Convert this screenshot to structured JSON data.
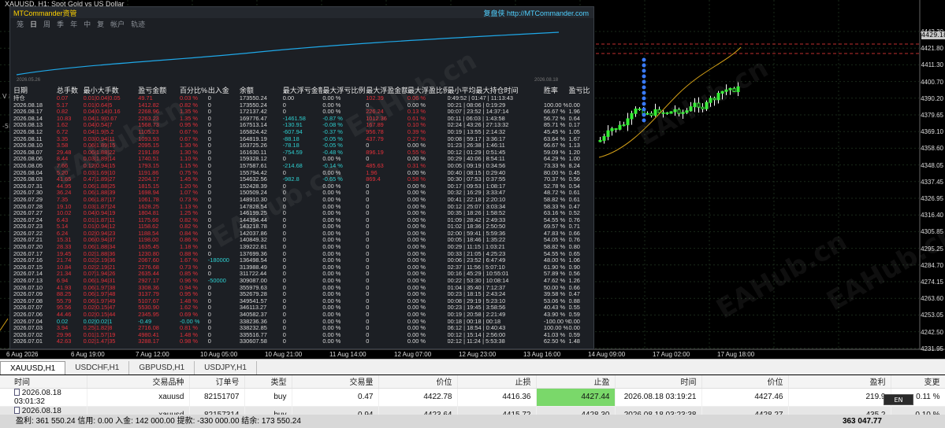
{
  "chart": {
    "title": "XAUUSD, H1:  Spot Gold vs US Dollar",
    "prices": [
      "4442.30",
      "4421.80",
      "4411.30",
      "4400.70",
      "4390.20",
      "4379.65",
      "4369.10",
      "4358.60",
      "4348.05",
      "4337.45",
      "4326.95",
      "4316.40",
      "4305.85",
      "4295.25",
      "4284.70",
      "4274.15",
      "4263.60",
      "4253.05",
      "4242.50",
      "4231.95"
    ],
    "current_price": "4429.18",
    "times": [
      "6 Aug 2026",
      "6 Aug 19:00",
      "7 Aug 12:00",
      "10 Aug 05:00",
      "10 Aug 21:00",
      "11 Aug 14:00",
      "12 Aug 07:00",
      "12 Aug 23:00",
      "13 Aug 16:00",
      "14 Aug 09:00",
      "17 Aug 02:00",
      "17 Aug 18:00"
    ],
    "left_markers": [
      "V 8.18",
      "-5L"
    ],
    "watermarks": [
      "EAHub.cn",
      "EAHub.cn",
      "EAHub.cn",
      "EAHub.cn",
      "EAHub.cn",
      "EAHub.cn"
    ]
  },
  "panel": {
    "brand": "MTCommander资管",
    "link": "复盘侠 http://MTCommander.com",
    "tabs": [
      "笼",
      "日",
      "周",
      "季",
      "年",
      "中",
      "复",
      "帐户",
      "轨迹"
    ],
    "equity_dates": [
      "2026.05.26",
      "2026.08.18"
    ],
    "headers": [
      "日期",
      "总手数",
      "最小大手数",
      "盈亏金额",
      "百分比%",
      "出入金",
      "余额",
      "最大浮亏金额",
      "最大浮亏比例",
      "最大浮盈金额",
      "最大浮盈比例",
      "最小平均最大持仓时间",
      "胜率",
      "盈亏比"
    ],
    "rows": [
      [
        "持仓",
        "0.07",
        "0.01|0.04|0.05",
        "49.71",
        "0.03 %",
        "0",
        "173550.24",
        "0.00",
        "0.00 %",
        "102.39",
        "0.06 %",
        "0:49:52 | 01:47 | 11:13:43",
        "",
        ""
      ],
      [
        "2026.08.18",
        "5.17",
        "0.01|0.64|5",
        "1412.82",
        "0.82 %",
        "0",
        "173550.24",
        "0",
        "0.00 %",
        "0",
        "0.00 %",
        "00:21 | 08:06 | 0:19:29",
        "100.00 %",
        "0.00"
      ],
      [
        "2026.08.17",
        "0.82",
        "0.04|0.14|0.16",
        "2268.96",
        "1.35 %",
        "0",
        "172137.42",
        "0",
        "0.00 %",
        "226.24",
        "0.13 %",
        "00:07 | 23:52 | 14:37:14",
        "66.67 %",
        "1.96"
      ],
      [
        "2026.08.14",
        "10.83",
        "0.04|1.9|0.67",
        "2263.23",
        "1.35 %",
        "0",
        "169776.47",
        "-1461.58",
        "-0.87 %",
        "1012.36",
        "0.61 %",
        "00:11 | 06:03 | 1:43:58",
        "56.72 %",
        "0.64"
      ],
      [
        "2026.08.13",
        "1.62",
        "0.04|0.54|7",
        "1568.73",
        "0.95 %",
        "0",
        "167513.14",
        "-130.91",
        "-0.08 %",
        "167.89",
        "0.10 %",
        "02:24 | 43:26 | 27:13:32",
        "85.71 %",
        "0.17"
      ],
      [
        "2026.08.12",
        "6.72",
        "0.04|1.9|5.2",
        "1105.23",
        "0.67 %",
        "0",
        "165824.42",
        "-607.94",
        "-0.37 %",
        "956.78",
        "0.39 %",
        "00:19 | 13:55 | 2:14:32",
        "45.45 %",
        "1.05"
      ],
      [
        "2026.08.11",
        "3.35",
        "0.03|0.94|11",
        "1093.93",
        "0.67 %",
        "0",
        "164819.19",
        "-88.18",
        "-0.05 %",
        "437.79",
        "0.27 %",
        "00:08 | 59:17 | 3:36:17",
        "63.64 %",
        "1.67"
      ],
      [
        "2026.08.10",
        "3.58",
        "0.06|1.89|15",
        "2095.15",
        "1.30 %",
        "0",
        "163725.26",
        "-78.18",
        "-0.05 %",
        "0",
        "0.00 %",
        "01:23 | 26:38 | 1:46:11",
        "66.67 %",
        "1.13"
      ],
      [
        "2026.08.07",
        "29.48",
        "0.06|1.88|22",
        "2191.89",
        "1.30 %",
        "0",
        "161630.11",
        "-754.59",
        "-0.48 %",
        "896.19",
        "0.55 %",
        "00:12 | 01:29 | 0:51:45",
        "59.09 %",
        "1.20"
      ],
      [
        "2026.08.06",
        "8.44",
        "0.03|1.89|14",
        "1740.51",
        "1.10 %",
        "0",
        "159328.12",
        "0",
        "0.00 %",
        "0",
        "0.00 %",
        "00:29 | 40:06 | 8:54:11",
        "64.29 %",
        "1.00"
      ],
      [
        "2026.08.05",
        "7.66",
        "0.12|0.94|15",
        "1793.15",
        "1.15 %",
        "0",
        "157587.61",
        "-214.68",
        "-0.14 %",
        "485.63",
        "0.31 %",
        "00:05 | 09:19 | 0:34:56",
        "73.33 %",
        "8.24"
      ],
      [
        "2026.08.04",
        "5.20",
        "0.03|1.69|10",
        "1191.86",
        "0.75 %",
        "0",
        "155794.42",
        "0",
        "0.00 %",
        "1.96",
        "0.00 %",
        "00:40 | 08:15 | 0:29:40",
        "80.00 %",
        "0.45"
      ],
      [
        "2026.08.03",
        "41.65",
        "0.47|1.89|27",
        "2204.17",
        "1.45 %",
        "0",
        "154632.56",
        "-982.8",
        "-0.65 %",
        "869.4",
        "0.58 %",
        "00:30 | 07:53 | 0:37:55",
        "70.37 %",
        "0.56"
      ],
      [
        "2026.07.31",
        "44.95",
        "0.06|1.88|25",
        "1815.15",
        "1.20 %",
        "0",
        "152428.39",
        "0",
        "0.00 %",
        "0",
        "0.00 %",
        "00:17 | 09:53 | 1:08:17",
        "52.78 %",
        "0.54"
      ],
      [
        "2026.07.30",
        "36.24",
        "0.06|1.88|39",
        "1698.94",
        "1.07 %",
        "0",
        "150509.24",
        "0",
        "0.00 %",
        "0",
        "0.00 %",
        "00:32 | 16:29 | 3:33:47",
        "48.72 %",
        "0.61"
      ],
      [
        "2026.07.29",
        "7.35",
        "0.06|1.87|17",
        "1061.78",
        "0.73 %",
        "0",
        "148910.30",
        "0",
        "0.00 %",
        "0",
        "0.00 %",
        "00:41 | 22:18 | 2:20:10",
        "58.82 %",
        "0.61"
      ],
      [
        "2026.07.28",
        "19.10",
        "0.03|1.87|24",
        "1628.25",
        "1.13 %",
        "0",
        "147828.54",
        "0",
        "0.00 %",
        "0",
        "0.00 %",
        "00:12 | 25:07 | 3:03:34",
        "58.33 %",
        "0.47"
      ],
      [
        "2026.07.27",
        "10.02",
        "0.04|0.94|19",
        "1804.81",
        "1.25 %",
        "0",
        "146199.25",
        "0",
        "0.00 %",
        "0",
        "0.00 %",
        "00:35 | 18:26 | 1:58:52",
        "63.16 %",
        "0.52"
      ],
      [
        "2026.07.24",
        "6.43",
        "0.01|1.87|11",
        "1175.66",
        "0.82 %",
        "0",
        "144394.44",
        "0",
        "0.00 %",
        "0",
        "0.00 %",
        "01:09 | 28:42 | 2:49:33",
        "54.55 %",
        "0.76"
      ],
      [
        "2026.07.23",
        "5.14",
        "0.01|0.94|12",
        "1158.62",
        "0.82 %",
        "0",
        "143218.78",
        "0",
        "0.00 %",
        "0",
        "0.00 %",
        "01:02 | 18:36 | 2:50:50",
        "69.57 %",
        "0.71"
      ],
      [
        "2026.07.22",
        "6.24",
        "0.02|0.94|23",
        "1188.54",
        "0.84 %",
        "0",
        "142037.86",
        "0",
        "0.00 %",
        "0",
        "0.00 %",
        "02:00 | 59:41 | 5:59:36",
        "47.83 %",
        "0.66"
      ],
      [
        "2026.07.21",
        "15.31",
        "0.06|0.94|37",
        "1198.00",
        "0.86 %",
        "0",
        "140849.32",
        "0",
        "0.00 %",
        "0",
        "0.00 %",
        "00:05 | 18:46 | 1:35:22",
        "54.05 %",
        "0.76"
      ],
      [
        "2026.07.20",
        "28.33",
        "0.06|1.88|34",
        "1635.45",
        "1.18 %",
        "0",
        "139222.81",
        "0",
        "0.00 %",
        "0",
        "0.00 %",
        "00:29 | 11:15 | 1:03:21",
        "58.82 %",
        "0.80"
      ],
      [
        "2026.07.17",
        "19.45",
        "0.02|1.88|36",
        "1230.80",
        "0.88 %",
        "0",
        "137699.36",
        "0",
        "0.00 %",
        "0",
        "0.00 %",
        "00:33 | 21:05 | 4:25:23",
        "54.55 %",
        "0.65"
      ],
      [
        "2026.07.16",
        "21.74",
        "0.02|2.19|36",
        "2067.60",
        "1.67 %",
        "-180000",
        "136498.54",
        "0",
        "0.00 %",
        "0",
        "0.00 %",
        "00:06 | 23:52 | 6:47:49",
        "48.00 %",
        "1.06"
      ],
      [
        "2026.07.15",
        "10.84",
        "0.02|2.19|21",
        "2276.68",
        "0.73 %",
        "0",
        "313988.49",
        "0",
        "0.00 %",
        "0",
        "0.00 %",
        "02:37 | 11:56 | 5:07:10",
        "61.90 %",
        "0.90"
      ],
      [
        "2026.07.14",
        "21.34",
        "0.07|1.94|26",
        "2635.44",
        "0.85 %",
        "0",
        "311722.44",
        "0",
        "0.00 %",
        "0",
        "0.00 %",
        "00:16 | 45:29 | 10:55:01",
        "57.89 %",
        "0.56"
      ],
      [
        "2026.07.13",
        "6.94",
        "0.06|1.94|31",
        "2927.17",
        "0.96 %",
        "-50000",
        "309087.00",
        "0",
        "0.00 %",
        "0",
        "0.00 %",
        "00:22 | 53:30 | 10:08:14",
        "47.62 %",
        "1.26"
      ],
      [
        "2026.07.10",
        "41.93",
        "0.06|1.97|38",
        "3308.36",
        "0.94 %",
        "0",
        "355979.63",
        "0",
        "0.00 %",
        "0",
        "0.00 %",
        "01:04 | 35:40 | 7:12:37",
        "50.00 %",
        "0.66"
      ],
      [
        "2026.07.09",
        "88.25",
        "0.06|1.97|48",
        "3137.79",
        "0.95 %",
        "0",
        "352679.28",
        "0",
        "0.00 %",
        "0",
        "0.00 %",
        "00:23 | 18:15 | 2:43:24",
        "39.58 %",
        "0.47"
      ],
      [
        "2026.07.08",
        "55.79",
        "0.06|1.97|49",
        "5107.67",
        "1.48 %",
        "0",
        "349541.57",
        "0",
        "0.00 %",
        "0",
        "0.00 %",
        "00:08 | 29:19 | 5:23:10",
        "53.06 %",
        "0.88"
      ],
      [
        "2026.07.07",
        "95.56",
        "0.02|0.15|47",
        "5530.90",
        "1.62 %",
        "0",
        "346113.27",
        "0",
        "0.00 %",
        "0",
        "0.00 %",
        "00:23 | 19:45 | 3:58:56",
        "40.43 %",
        "0.55"
      ],
      [
        "2026.07.06",
        "44.46",
        "0.02|0.15|44",
        "2345.95",
        "0.69 %",
        "0",
        "340582.37",
        "0",
        "0.00 %",
        "0",
        "0.00 %",
        "00:19 | 20:58 | 2:21:49",
        "43.90 %",
        "0.59"
      ],
      [
        "2026.07.04",
        "0.02",
        "0.02|0.02|1",
        "-0.49",
        "-0.00 %",
        "0",
        "338236.36",
        "0",
        "0.00 %",
        "0",
        "0.00 %",
        "00:18 | 00:18 | 00:18",
        "-100.00 %",
        "0.00"
      ],
      [
        "2026.07.03",
        "3.94",
        "0.25|1.82|8",
        "2716.08",
        "0.81 %",
        "0",
        "338232.85",
        "0",
        "0.00 %",
        "0",
        "0.00 %",
        "06:12 | 18:54 | 0:40:43",
        "100.00 %",
        "0.00"
      ],
      [
        "2026.07.02",
        "29.96",
        "0.01|1.57|19",
        "4980.41",
        "1.48 %",
        "0",
        "335516.77",
        "0",
        "0.00 %",
        "0",
        "0.00 %",
        "00:12 | 15:14 | 2:56:00",
        "41.03 %",
        "0.59"
      ],
      [
        "2026.07.01",
        "42.63",
        "0.02|1.47|35",
        "3288.17",
        "0.98 %",
        "0",
        "330607.58",
        "0",
        "0.00 %",
        "0",
        "0.00 %",
        "02:12 | 11:24 | 5:53:38",
        "62.50 %",
        "1.48"
      ]
    ]
  },
  "symbol_tabs": [
    "XAUUSD,H1",
    "USDCHF,H1",
    "GBPUSD,H1",
    "USDJPY,H1"
  ],
  "positions": {
    "headers": [
      "时间",
      "交易品种",
      "订单号",
      "类型",
      "交易量",
      "价位",
      "止损",
      "止盈",
      "时间",
      "价位",
      "盈利",
      "变更"
    ],
    "rows": [
      [
        "2026.08.18 03:01:32",
        "xauusd",
        "82151707",
        "buy",
        "0.47",
        "4422.78",
        "4416.36",
        "4427.44",
        "2026.08.18 03:19:21",
        "4427.46",
        "219.9",
        "0.11 %"
      ],
      [
        "2026.08.18 03:04:09",
        "xauusd",
        "82157314",
        "buy",
        "0.94",
        "4423.64",
        "4415.72",
        "4428.30",
        "2026.08.18 03:23:38",
        "4428.27",
        "435.2",
        "0.10 %"
      ]
    ],
    "summary": "盈利: 361 550.24  信用: 0.00  入金: 142 000.00  提款: -330 000.00  结余: 173 550.24",
    "total": "363 047.77",
    "lang_badge": "EN"
  },
  "colors": {
    "loss": "#e2303a",
    "gain": "#2ecfd0",
    "tp": "#7ad86a",
    "accent": "#1a3fd0"
  }
}
